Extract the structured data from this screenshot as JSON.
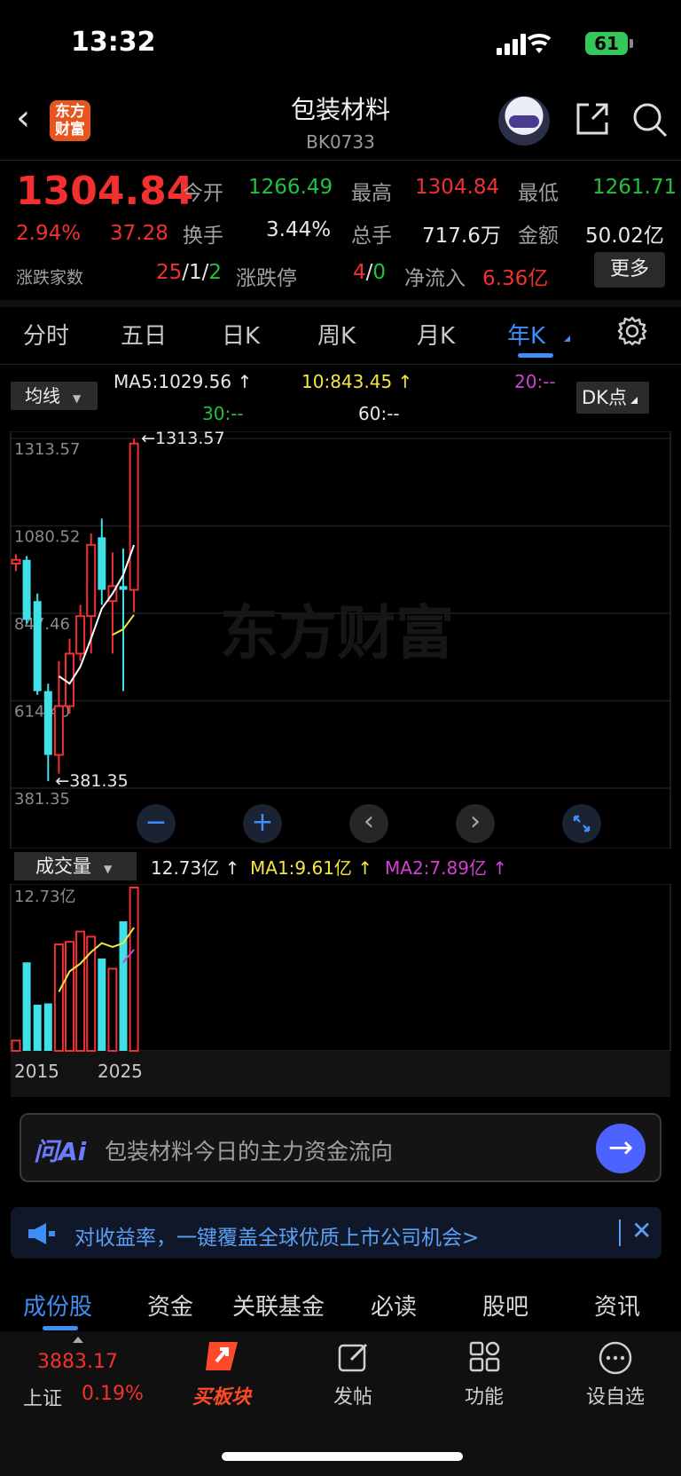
{
  "status_bar": {
    "time": "13:32",
    "battery": "61"
  },
  "header": {
    "logo_text": "东方财富",
    "title": "包装材料",
    "code": "BK0733"
  },
  "quote": {
    "price": "1304.84",
    "change_pct": "2.94%",
    "change": "37.28",
    "open_label": "今开",
    "open": "1266.49",
    "high_label": "最高",
    "high": "1304.84",
    "low_label": "最低",
    "low": "1261.71",
    "turnover_label": "换手",
    "turnover": "3.44%",
    "volume_label": "总手",
    "volume": "717.6万",
    "amount_label": "金额",
    "amount": "50.02亿",
    "updown_label": "涨跌家数",
    "up": "25",
    "sep1": "/",
    "flat": "1",
    "sep2": "/",
    "down": "2",
    "limit_label": "涨跌停",
    "limit_up": "4",
    "limit_sep": "/",
    "limit_down": "0",
    "netflow_label": "净流入",
    "netflow": "6.36亿",
    "more": "更多"
  },
  "tabs": [
    "分时",
    "五日",
    "日K",
    "周K",
    "月K",
    "年K"
  ],
  "active_tab": "年K",
  "ma_bar": {
    "selector": "均线",
    "ma5": "MA5:1029.56",
    "ma10": "10:843.45",
    "ma20": "20:--",
    "ma30": "30:--",
    "ma60": "60:--",
    "dk": "DK点"
  },
  "chart_data": [
    {
      "type": "candlestick",
      "y_axis_labels": [
        "1313.57",
        "1080.52",
        "847.46",
        "614.40",
        "381.35"
      ],
      "ylim": [
        381.35,
        1313.57
      ],
      "max_label": "←1313.57",
      "min_label": "←381.35",
      "watermark": "东方财富",
      "candles": [
        {
          "o": 980,
          "c": 990,
          "h": 1005,
          "l": 960,
          "color": "red"
        },
        {
          "o": 990,
          "c": 830,
          "h": 1000,
          "l": 820,
          "color": "cyan"
        },
        {
          "o": 880,
          "c": 640,
          "h": 900,
          "l": 630,
          "color": "cyan"
        },
        {
          "o": 640,
          "c": 470,
          "h": 660,
          "l": 400,
          "color": "cyan"
        },
        {
          "o": 470,
          "c": 600,
          "h": 720,
          "l": 420,
          "color": "red"
        },
        {
          "o": 600,
          "c": 740,
          "h": 780,
          "l": 580,
          "color": "red"
        },
        {
          "o": 740,
          "c": 840,
          "h": 870,
          "l": 720,
          "color": "red"
        },
        {
          "o": 840,
          "c": 1030,
          "h": 1060,
          "l": 740,
          "color": "red"
        },
        {
          "o": 1050,
          "c": 910,
          "h": 1100,
          "l": 870,
          "color": "cyan"
        },
        {
          "o": 880,
          "c": 920,
          "h": 1010,
          "l": 740,
          "color": "red"
        },
        {
          "o": 920,
          "c": 910,
          "h": 1020,
          "l": 640,
          "color": "cyan"
        },
        {
          "o": 910,
          "c": 1300,
          "h": 1313.57,
          "l": 850,
          "color": "red"
        }
      ],
      "ma5": [
        null,
        null,
        null,
        null,
        680,
        660,
        705,
        780,
        860,
        900,
        950,
        1029.56
      ],
      "ma10": [
        null,
        null,
        null,
        null,
        null,
        null,
        null,
        null,
        null,
        790,
        805,
        843.45
      ]
    },
    {
      "type": "bar",
      "title": "成交量",
      "current": "12.73亿",
      "ma1": "MA1:9.61亿",
      "ma2": "MA2:7.89亿",
      "y_top_label": "12.73亿",
      "x_labels": [
        "2015",
        "2025"
      ],
      "ylim": [
        0,
        12.73
      ],
      "values": [
        0.8,
        6.9,
        3.6,
        3.7,
        8.3,
        8.5,
        9.3,
        8.9,
        7.2,
        6.4,
        10.1,
        12.73
      ],
      "colors": [
        "red",
        "cyan",
        "cyan",
        "cyan",
        "red",
        "red",
        "red",
        "red",
        "cyan",
        "red",
        "cyan",
        "red"
      ],
      "ma1_line": [
        null,
        null,
        null,
        null,
        4.6,
        6.2,
        6.8,
        7.7,
        8.4,
        8.1,
        8.4,
        9.61
      ],
      "ma2_line": [
        null,
        null,
        null,
        null,
        null,
        null,
        null,
        null,
        null,
        null,
        6.9,
        7.89
      ]
    }
  ],
  "ai_bar": {
    "logo": "问Ai",
    "prompt": "包装材料今日的主力资金流向"
  },
  "banner": {
    "text": "对收益率，一键覆盖全球优质上市公司机会>"
  },
  "bottom_tabs": [
    "成份股",
    "资金",
    "关联基金",
    "必读",
    "股吧",
    "资讯"
  ],
  "nav": {
    "index_value": "3883.17",
    "index_name": "上证",
    "index_change": "0.19%",
    "buy_sector": "买板块",
    "post": "发帖",
    "functions": "功能",
    "watchlist": "设自选"
  },
  "colors": {
    "up": "#f23030",
    "down": "#3fe0e8",
    "accent": "#3d8ff5",
    "ma5": "#ffffff",
    "ma10": "#f5e642"
  }
}
